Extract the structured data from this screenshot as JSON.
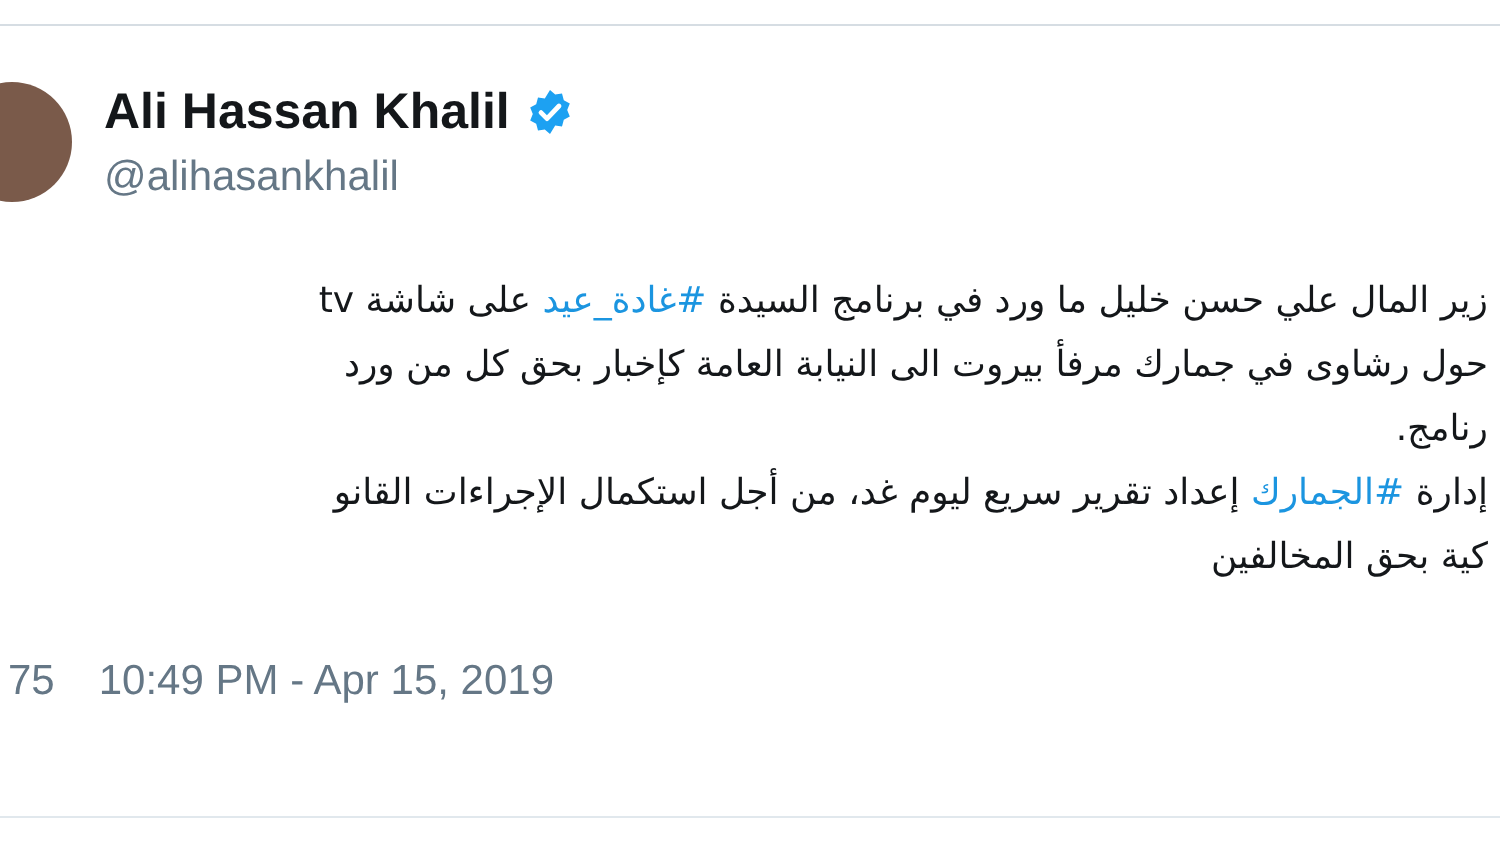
{
  "author": {
    "name": "Ali Hassan Khalil",
    "verified": true,
    "handle": "@alihasankhalil"
  },
  "tweet_lines": [
    [
      {
        "kind": "text",
        "text": "زير المال علي حسن خليل ما ورد في برنامج السيدة "
      },
      {
        "kind": "hashtag",
        "text": "#غادة_عيد"
      },
      {
        "kind": "text",
        "text": " على شاشة tv"
      }
    ],
    [
      {
        "kind": "text",
        "text": "حول رشاوى في جمارك مرفأ بيروت الى النيابة العامة كإخبار بحق كل من ورد"
      }
    ],
    [
      {
        "kind": "text",
        "text": "رنامج."
      }
    ],
    [
      {
        "kind": "text",
        "text": "إدارة "
      },
      {
        "kind": "hashtag",
        "text": "#الجمارك"
      },
      {
        "kind": "text",
        "text": " إعداد تقرير سريع ليوم غد، من أجل استكمال الإجراءات القانو"
      }
    ],
    [
      {
        "kind": "text",
        "text": "كية بحق المخالفين"
      }
    ]
  ],
  "footer": {
    "count": "75",
    "timestamp": "10:49 PM - Apr 15, 2019"
  }
}
